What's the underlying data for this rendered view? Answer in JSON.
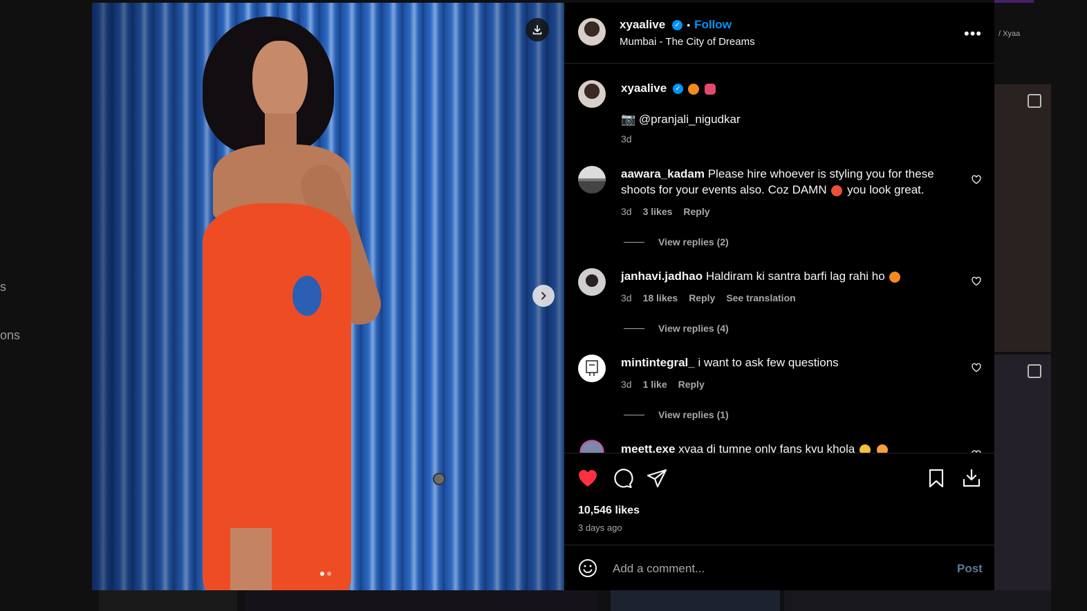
{
  "background": {
    "left_texts": [
      "s",
      "ons"
    ],
    "chip_text": "/ Xyaa"
  },
  "post": {
    "username": "xyaalive",
    "verified": true,
    "follow_label": "Follow",
    "separator": "•",
    "location": "Mumbai - The City of Dreams",
    "more_label": "•••",
    "image_count": 2,
    "current_image": 1
  },
  "caption": {
    "username": "xyaalive",
    "emojis": [
      "orange",
      "butterfly"
    ],
    "camera_emoji": "📷",
    "text": "@pranjali_nigudkar",
    "time": "3d"
  },
  "comments": [
    {
      "username": "aawara_kadam",
      "text": "Please hire whoever is styling you for these shoots for your events also. Coz DAMN",
      "text_suffix": "you look great.",
      "emoji": "hot-face",
      "time": "3d",
      "likes": "3 likes",
      "reply": "Reply",
      "translation": "",
      "view_replies": "View replies (2)"
    },
    {
      "username": "janhavi.jadhao",
      "text": "Haldiram ki santra barfi lag rahi ho",
      "text_suffix": "",
      "emoji": "orange",
      "time": "3d",
      "likes": "18 likes",
      "reply": "Reply",
      "translation": "See translation",
      "view_replies": "View replies (4)"
    },
    {
      "username": "mintintegral_",
      "text": "i want to ask few questions",
      "text_suffix": "",
      "emoji": "",
      "time": "3d",
      "likes": "1 like",
      "reply": "Reply",
      "translation": "",
      "view_replies": "View replies (1)"
    },
    {
      "username": "meett.exe",
      "text": "xyaa di tumne only fans kyu khola",
      "text_suffix": "",
      "emoji": "flushed-crying",
      "time": "",
      "likes": "",
      "reply": "",
      "translation": "",
      "view_replies": ""
    }
  ],
  "actions": {
    "liked": true,
    "likes": "10,546 likes",
    "time_ago": "3 days ago"
  },
  "composer": {
    "placeholder": "Add a comment...",
    "post_label": "Post"
  },
  "colors": {
    "accent": "#0095f6",
    "like": "#ff3040",
    "muted": "#a8a8a8",
    "post_disabled": "#5a7a98"
  }
}
